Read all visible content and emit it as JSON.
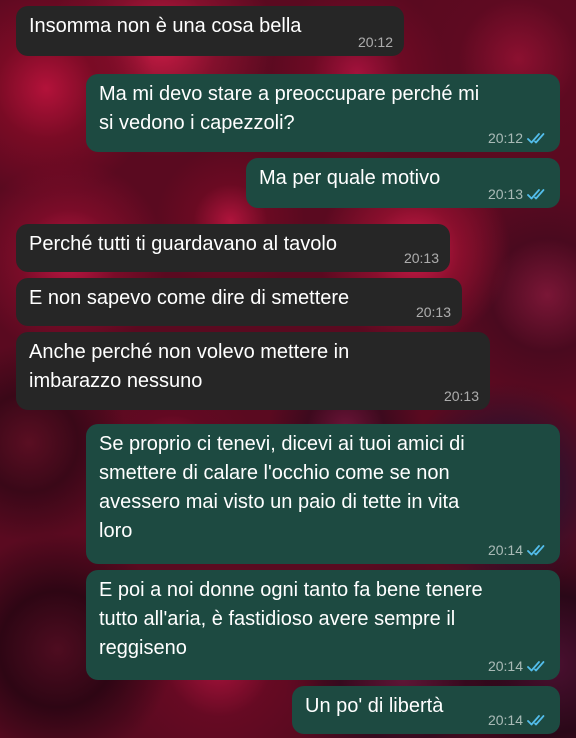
{
  "messages": [
    {
      "direction": "incoming",
      "text": "Insomma non è una cosa bella",
      "time": "20:12"
    },
    {
      "direction": "outgoing",
      "text": "Ma mi devo stare a preoccupare perché mi\nsi vedono i capezzoli?",
      "time": "20:12",
      "status_icon": "double-check-read-icon"
    },
    {
      "direction": "outgoing",
      "text": "Ma per quale motivo",
      "time": "20:13",
      "status_icon": "double-check-read-icon"
    },
    {
      "direction": "incoming",
      "text": "Perché tutti ti guardavano al tavolo",
      "time": "20:13"
    },
    {
      "direction": "incoming",
      "text": "E non sapevo come dire di smettere",
      "time": "20:13"
    },
    {
      "direction": "incoming",
      "text": "Anche perché non volevo mettere in\nimbarazzo nessuno",
      "time": "20:13"
    },
    {
      "direction": "outgoing",
      "text": "Se proprio ci tenevi, dicevi ai tuoi amici di\nsmettere di calare l'occhio come se non\navessero mai visto un paio di tette in vita\nloro",
      "time": "20:14",
      "status_icon": "double-check-read-icon"
    },
    {
      "direction": "outgoing",
      "text": "E poi a noi donne ogni tanto fa bene tenere\ntutto all'aria, è fastidioso avere sempre il\nreggiseno",
      "time": "20:14",
      "status_icon": "double-check-read-icon"
    },
    {
      "direction": "outgoing",
      "text": "Un po' di libertà",
      "time": "20:14",
      "status_icon": "double-check-read-icon"
    }
  ],
  "colors": {
    "incoming_bubble": "#262626",
    "outgoing_bubble": "#1d4a41",
    "read_ticks": "#53bdeb",
    "background": "#5a0a20"
  }
}
